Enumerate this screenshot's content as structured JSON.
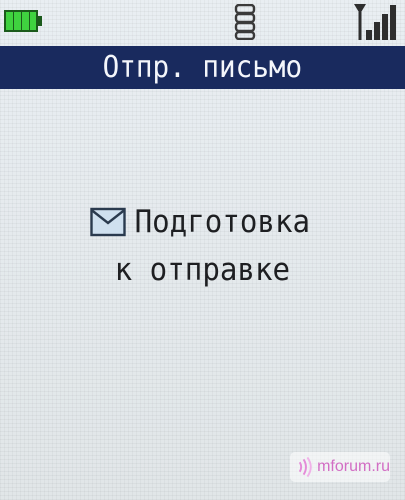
{
  "status": {
    "battery_icon": "battery-full-icon",
    "network_icon": "sim-stack-icon",
    "signal_icon": "signal-strength-icon",
    "battery_color": "#36c23a",
    "signal_color": "#2e2e2e"
  },
  "header": {
    "title": "Отпр. письмо",
    "background": "#192a5e"
  },
  "message": {
    "icon": "envelope-icon",
    "line1": "Подготовка",
    "line2": "к отправке"
  },
  "watermark": {
    "text": "mforum.ru",
    "color": "#d26ec4"
  }
}
